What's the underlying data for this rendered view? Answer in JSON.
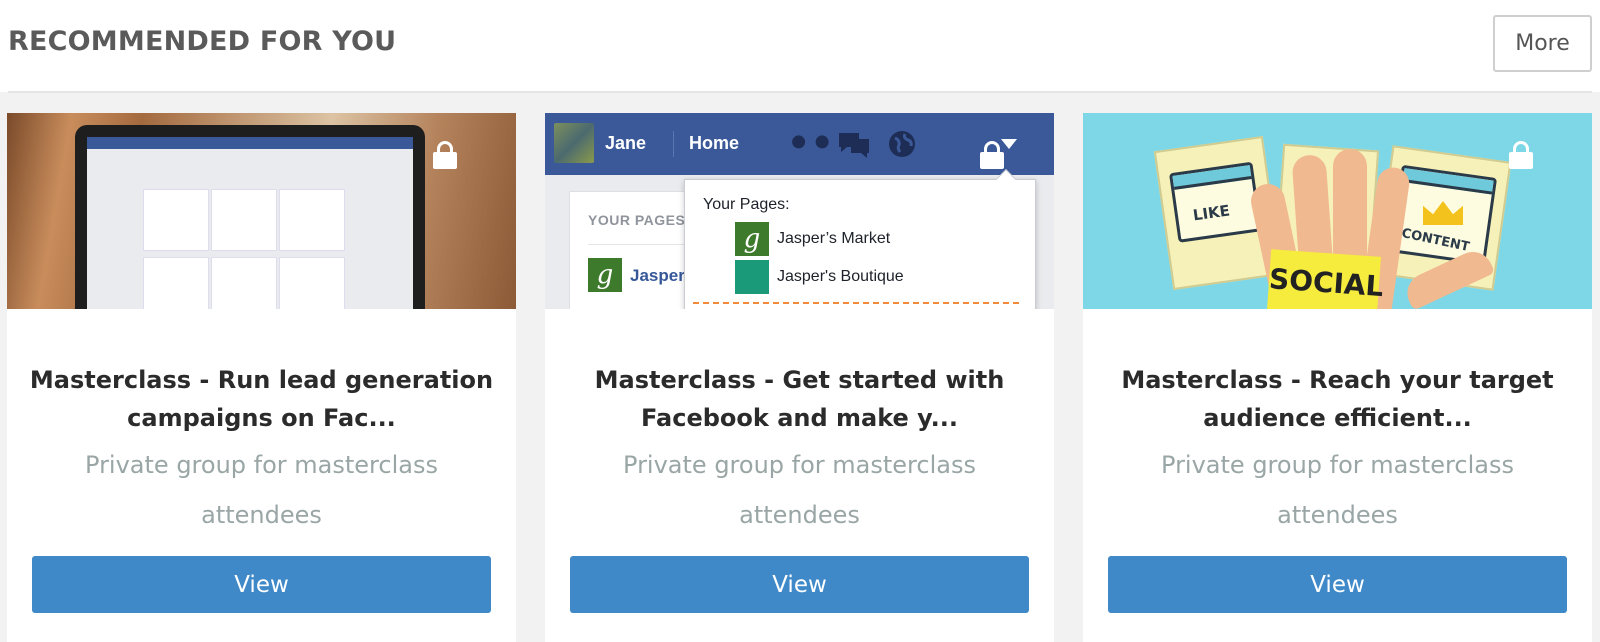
{
  "header": {
    "title": "RECOMMENDED FOR YOU",
    "more_label": "More"
  },
  "cards": [
    {
      "title": "Masterclass - Run lead generation campaigns on Fac...",
      "description": "Private group for masterclass attendees",
      "button_label": "View",
      "locked": true
    },
    {
      "title": "Masterclass - Get started with Facebook and make y...",
      "description": "Private group for masterclass attendees",
      "button_label": "View",
      "locked": true,
      "thumbnail": {
        "user_name": "Jane",
        "home_label": "Home",
        "pages_panel_label": "YOUR PAGES",
        "pages_panel_item": "Jasper",
        "dropdown_title": "Your Pages:",
        "dropdown_items": [
          "Jasper’s Market",
          "Jasper's Boutique"
        ]
      }
    },
    {
      "title": "Masterclass - Reach your target audience efficient...",
      "description": "Private group for masterclass attendees",
      "button_label": "View",
      "locked": true,
      "thumbnail": {
        "note_texts": [
          "LIKE",
          "CONTENT",
          "SOCIAL"
        ]
      }
    }
  ],
  "colors": {
    "button": "#3f89c8",
    "page_background": "#f2f2f2",
    "facebook_blue": "#3b5998"
  },
  "icons": [
    "lock-icon",
    "friends-icon",
    "messages-icon",
    "globe-icon",
    "caret-down-icon"
  ]
}
